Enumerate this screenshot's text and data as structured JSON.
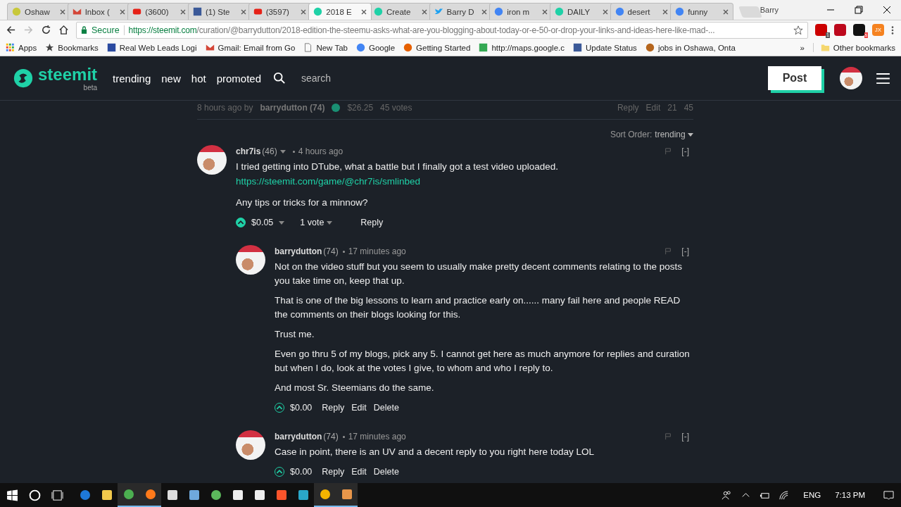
{
  "browser": {
    "tabs": [
      {
        "title": "Oshaw",
        "kind": "globe",
        "selected": false
      },
      {
        "title": "Inbox (",
        "kind": "gmail",
        "selected": false
      },
      {
        "title": "(3600)",
        "kind": "youtube",
        "selected": false
      },
      {
        "title": "(1) Ste",
        "kind": "facebook",
        "selected": false
      },
      {
        "title": "(3597)",
        "kind": "youtube",
        "selected": false
      },
      {
        "title": "2018 E",
        "kind": "steemit",
        "selected": true
      },
      {
        "title": "Create",
        "kind": "steemit",
        "selected": false
      },
      {
        "title": "Barry D",
        "kind": "twitter",
        "selected": false
      },
      {
        "title": "iron m",
        "kind": "google",
        "selected": false
      },
      {
        "title": "DAILY",
        "kind": "steemit",
        "selected": false
      },
      {
        "title": "desert",
        "kind": "google",
        "selected": false
      },
      {
        "title": "funny",
        "kind": "google",
        "selected": false
      }
    ],
    "profile": "Barry",
    "secure_label": "Secure",
    "url_host": "https://steemit.com",
    "url_path": "/curation/@barrydutton/2018-edition-the-steemu-asks-what-are-you-blogging-about-today-or-e-50-or-drop-your-links-and-ideas-here-like-mad-...",
    "extensions": [
      {
        "kind": "abp",
        "badge": "1"
      },
      {
        "kind": "pinterest"
      },
      {
        "kind": "amazon",
        "badge": "s"
      },
      {
        "kind": "jx",
        "label": "JX"
      }
    ],
    "bookmarks": [
      {
        "label": "Apps",
        "kind": "apps"
      },
      {
        "label": "Bookmarks",
        "kind": "star"
      },
      {
        "label": "Real Web Leads Logi",
        "kind": "house"
      },
      {
        "label": "Gmail: Email from Go",
        "kind": "gmail"
      },
      {
        "label": "New Tab",
        "kind": "page"
      },
      {
        "label": "Google",
        "kind": "google"
      },
      {
        "label": "Getting Started",
        "kind": "firefox"
      },
      {
        "label": "http://maps.google.c",
        "kind": "maps"
      },
      {
        "label": "Update Status",
        "kind": "facebook"
      },
      {
        "label": "jobs in Oshawa, Onta",
        "kind": "e"
      }
    ],
    "overflow": "»",
    "other_bookmarks": "Other bookmarks"
  },
  "site": {
    "logo": "steemit",
    "logo_sub": "beta",
    "nav": [
      "trending",
      "new",
      "hot",
      "promoted"
    ],
    "search": "search",
    "post_button": "Post"
  },
  "post_footer": {
    "time": "8 hours ago by",
    "author": "barrydutton (74)",
    "payout": "$26.25",
    "votes": "45 votes",
    "actions": [
      "Reply",
      "Edit"
    ],
    "comments": "21",
    "views": "45"
  },
  "sort": {
    "label": "Sort Order:",
    "value": "trending"
  },
  "comments": [
    {
      "author": "chr7is",
      "rep": "(46)",
      "time": "4 hours ago",
      "collapse": "[-]",
      "voted": true,
      "paragraphs": [
        {
          "kind": "text",
          "text": "I tried getting into DTube, what a battle but I finally got a test video uploaded."
        },
        {
          "kind": "link",
          "text": "https://steemit.com/game/@chr7is/smlinbed"
        },
        {
          "kind": "text",
          "text": "Any tips or tricks for a minnow?"
        }
      ],
      "payout": "$0.05",
      "votes": "1 vote",
      "actions": [
        "Reply"
      ],
      "children": [
        {
          "author": "barrydutton",
          "rep": "(74)",
          "time": "17 minutes ago",
          "collapse": "[-]",
          "voted": false,
          "paragraphs": [
            {
              "kind": "text",
              "text": "Not on the video stuff but you seem to usually make pretty decent comments relating to the posts you take time on, keep that up."
            },
            {
              "kind": "text",
              "text": "That is one of the big lessons to learn and practice early on...... many fail here and people READ the comments on their blogs looking for this."
            },
            {
              "kind": "text",
              "text": "Trust me."
            },
            {
              "kind": "text",
              "text": "Even go thru 5 of my blogs, pick any 5. I cannot get here as much anymore for replies and curation but when I do, look at the votes I give, to whom and who I reply to."
            },
            {
              "kind": "text",
              "text": "And most Sr. Steemians do the same."
            }
          ],
          "payout": "$0.00",
          "actions": [
            "Reply",
            "Edit",
            "Delete"
          ]
        },
        {
          "author": "barrydutton",
          "rep": "(74)",
          "time": "17 minutes ago",
          "collapse": "[-]",
          "voted": false,
          "paragraphs": [
            {
              "kind": "text",
              "text": "Case in point, there is an UV and a decent reply to you right here today LOL"
            }
          ],
          "payout": "$0.00",
          "actions": [
            "Reply",
            "Edit",
            "Delete"
          ]
        }
      ]
    }
  ],
  "taskbar": {
    "apps": [
      {
        "kind": "edge",
        "active": false
      },
      {
        "kind": "folder",
        "active": false
      },
      {
        "kind": "chrome",
        "active": true
      },
      {
        "kind": "firefox",
        "active": true
      },
      {
        "kind": "calculator-grid",
        "active": false
      },
      {
        "kind": "paint",
        "active": false
      },
      {
        "kind": "globe",
        "active": false
      },
      {
        "kind": "mail",
        "active": false
      },
      {
        "kind": "calculator",
        "active": false
      },
      {
        "kind": "brave",
        "active": false
      },
      {
        "kind": "tool",
        "active": false
      },
      {
        "kind": "chrome-canary",
        "active": true
      },
      {
        "kind": "photo",
        "active": true
      }
    ],
    "language": "ENG",
    "clock": "7:13 PM"
  }
}
